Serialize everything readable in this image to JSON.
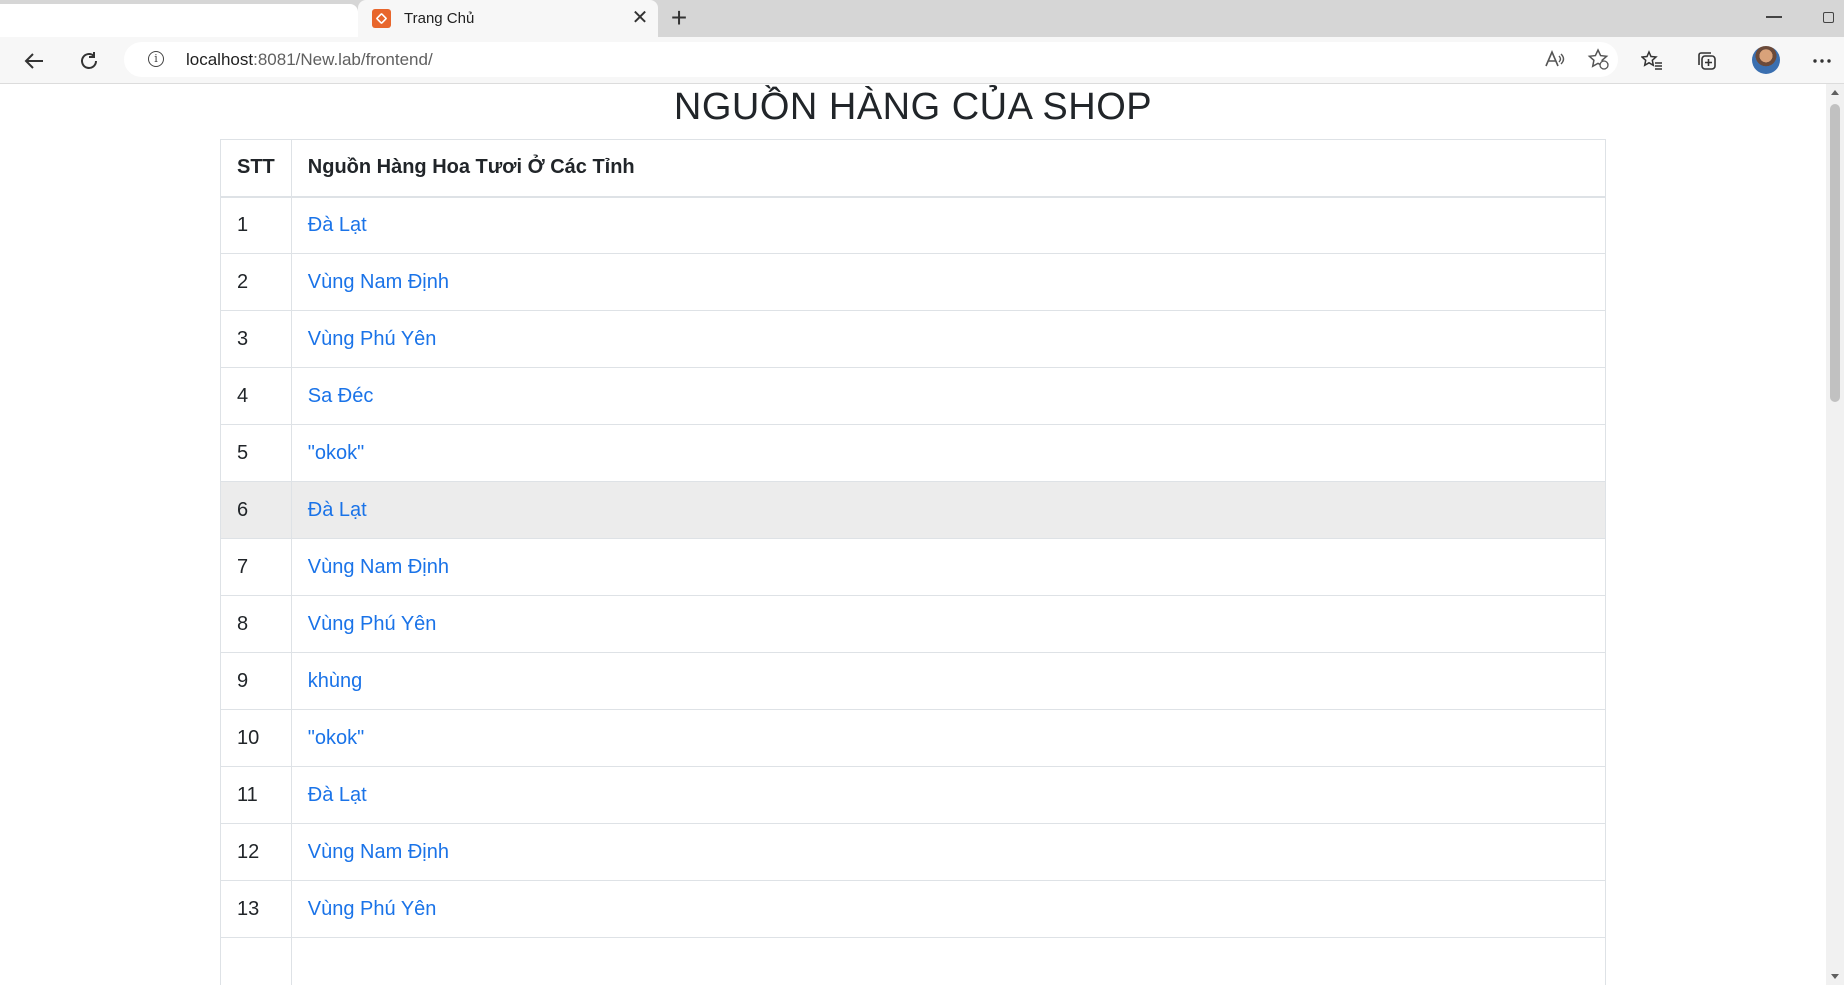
{
  "browser": {
    "tab_title": "Trang Chủ",
    "url_host": "localhost",
    "url_rest": ":8081/New.lab/frontend/"
  },
  "page": {
    "heading": "NGUỒN HÀNG CỦA SHOP",
    "table": {
      "headers": [
        "STT",
        "Nguồn Hàng Hoa Tươi Ở Các Tỉnh"
      ],
      "rows": [
        {
          "stt": "1",
          "name": "Đà Lạt"
        },
        {
          "stt": "2",
          "name": "Vùng Nam Định"
        },
        {
          "stt": "3",
          "name": "Vùng Phú Yên"
        },
        {
          "stt": "4",
          "name": "Sa Đéc"
        },
        {
          "stt": "5",
          "name": "\"okok\""
        },
        {
          "stt": "6",
          "name": "Đà Lạt"
        },
        {
          "stt": "7",
          "name": "Vùng Nam Định"
        },
        {
          "stt": "8",
          "name": "Vùng Phú Yên"
        },
        {
          "stt": "9",
          "name": "khùng"
        },
        {
          "stt": "10",
          "name": "\"okok\""
        },
        {
          "stt": "11",
          "name": "Đà Lạt"
        },
        {
          "stt": "12",
          "name": "Vùng Nam Định"
        },
        {
          "stt": "13",
          "name": "Vùng Phú Yên"
        }
      ]
    }
  },
  "colors": {
    "link": "#1a73e8",
    "hover_row": "#ececec",
    "favicon": "#e8662c"
  },
  "icons": [
    "back-icon",
    "refresh-icon",
    "info-icon",
    "read-aloud-icon",
    "add-favorite-icon",
    "favorites-icon",
    "collections-icon",
    "more-icon",
    "close-icon",
    "new-tab-icon"
  ]
}
